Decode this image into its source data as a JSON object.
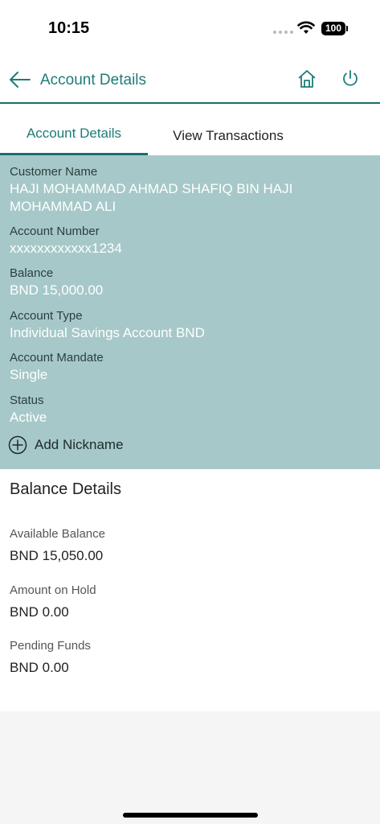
{
  "status_bar": {
    "time": "10:15",
    "battery": "100"
  },
  "header": {
    "title": "Account Details"
  },
  "tabs": [
    {
      "label": "Account Details"
    },
    {
      "label": "View Transactions"
    }
  ],
  "account": {
    "customer_name_label": "Customer Name",
    "customer_name": "HAJI MOHAMMAD AHMAD SHAFIQ BIN HAJI MOHAMMAD ALI",
    "account_number_label": "Account Number",
    "account_number": "xxxxxxxxxxxx1234",
    "balance_label": "Balance",
    "balance": "BND 15,000.00",
    "account_type_label": "Account Type",
    "account_type": "Individual Savings Account BND",
    "mandate_label": "Account Mandate",
    "mandate": "Single",
    "status_label": "Status",
    "status": "Active",
    "add_nickname": "Add Nickname"
  },
  "balance_details": {
    "title": "Balance Details",
    "available_label": "Available Balance",
    "available": "BND 15,050.00",
    "hold_label": "Amount on Hold",
    "hold": "BND 0.00",
    "pending_label": "Pending Funds",
    "pending": "BND 0.00"
  },
  "colors": {
    "accent": "#1d7c77",
    "details_bg": "#a6c8c8"
  },
  "icons": [
    "back-arrow-icon",
    "home-icon",
    "power-icon",
    "add-circle-icon",
    "wifi-icon"
  ]
}
